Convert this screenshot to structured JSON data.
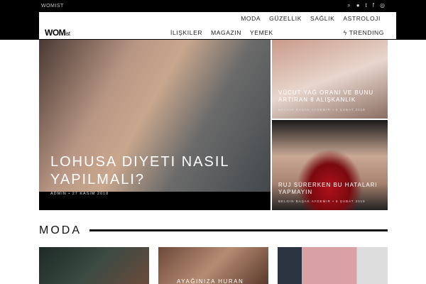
{
  "topbar": {
    "brand": "WOMIST",
    "icons": [
      "search-icon",
      "user-icon",
      "twitter-icon",
      "facebook-icon",
      "instagram-icon"
    ]
  },
  "logo": {
    "main": "WOM",
    "sub": "ist"
  },
  "nav_primary": [
    "MODA",
    "GÜZELLIK",
    "SAĞLIK",
    "ASTROLOJI"
  ],
  "nav_secondary": [
    "İLIŞKILER",
    "MAGAZIN",
    "YEMEK"
  ],
  "trending": "TRENDING",
  "featured": {
    "main": {
      "title": "LOHUSA DIYETI NASIL YAPILMALI?",
      "author": "ADMIN",
      "date": "27 KASIM 2018"
    },
    "side": [
      {
        "title": "VÜCUT YAĞ ORANI VE BUNU ARTIRAN 8 ALIŞKANLIK",
        "author": "BELGIN BAŞAK AYDEMIR",
        "date": "8 ŞUBAT 2018"
      },
      {
        "title": "RUJ SÜRERKEN BU HATALARI YAPMAYIN",
        "author": "BELGIN BAŞAK AYDEMIR",
        "date": "8 ŞUBAT 2018"
      }
    ]
  },
  "section": {
    "title": "MODA",
    "cards": [
      {
        "title": ""
      },
      {
        "title": "AYAĞINIZA HURAN"
      },
      {
        "title": ""
      }
    ]
  }
}
